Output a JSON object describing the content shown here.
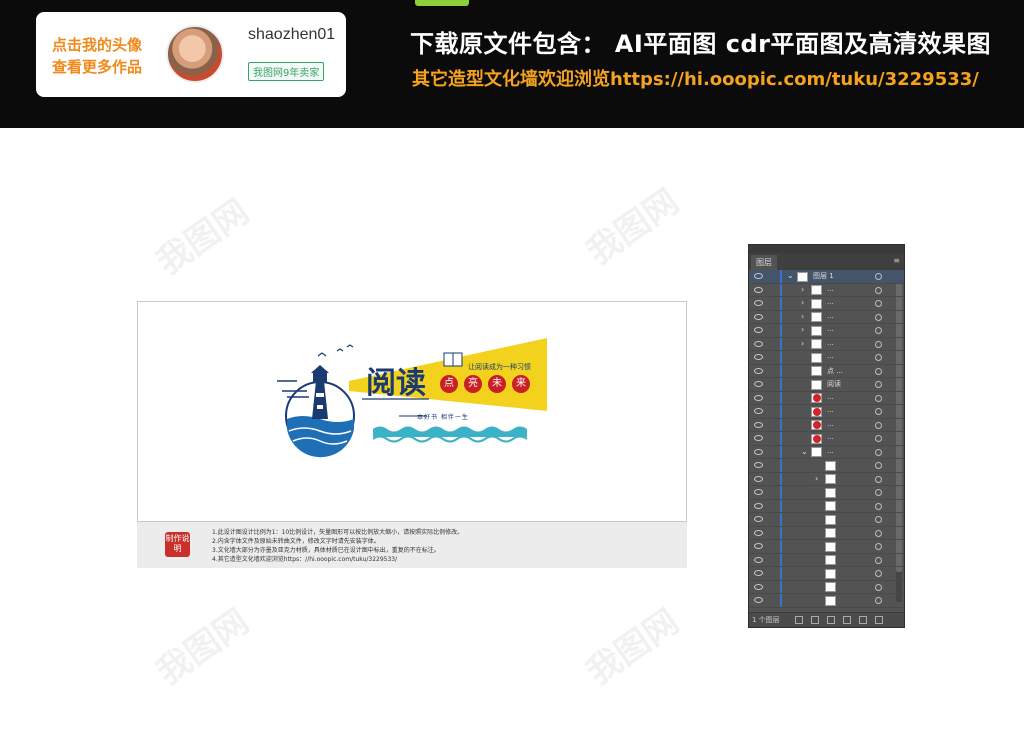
{
  "banner": {
    "author_cta": "点击我的头像 查看更多作品",
    "author_name": "shaozhen01",
    "seller_badge": "我图网9年卖家",
    "headline": "下载原文件包含： AI平面图  cdr平面图及高清效果图",
    "subline": "其它造型文化墙欢迎浏览https://hi.ooopic.com/tuku/3229533/"
  },
  "watermark": "我图网",
  "design": {
    "title": "阅读",
    "slogan": "让阅读成为一种习惯",
    "circle_words": [
      "点",
      "亮",
      "未",
      "来"
    ],
    "motto": "一本好书  相伴一生",
    "colors": {
      "navy": "#1a3a72",
      "yellow": "#f3d21e",
      "red": "#c91f25",
      "sea": "#2a8fc9"
    }
  },
  "notes": {
    "seal": "制作说明",
    "lines": [
      "1.此设计图设计比例为1：10比例设计，矢量图形可以按比例放大缩小，请按照实际比例修改。",
      "2.内含字体文件及原始未转曲文件，修改文字时请先安装字体。",
      "3.文化墙大部分为亦墨及亚克力材质，具体材质已在设计图中标出，重复的不在标注。",
      "4.其它造型文化墙欢迎浏览https：//hi.ooopic.com/tuku/3229533/"
    ]
  },
  "layers_panel": {
    "tab": "图层",
    "footer_count": "1 个图层",
    "rows": [
      {
        "name": "图层 1",
        "indent": 0,
        "twisty": "⌄",
        "thumb": "plain",
        "selected": true
      },
      {
        "name": "...",
        "indent": 1,
        "twisty": "›",
        "thumb": "plain"
      },
      {
        "name": "...",
        "indent": 1,
        "twisty": "›",
        "thumb": "plain"
      },
      {
        "name": "...",
        "indent": 1,
        "twisty": "›",
        "thumb": "plain"
      },
      {
        "name": "...",
        "indent": 1,
        "twisty": "›",
        "thumb": "plain"
      },
      {
        "name": "...",
        "indent": 1,
        "twisty": "›",
        "thumb": "plain"
      },
      {
        "name": "...",
        "indent": 1,
        "twisty": "",
        "thumb": "plain"
      },
      {
        "name": "点 ...",
        "indent": 1,
        "twisty": "",
        "thumb": "plain"
      },
      {
        "name": "阅读",
        "indent": 1,
        "twisty": "",
        "thumb": "plain"
      },
      {
        "name": "...",
        "indent": 1,
        "twisty": "",
        "thumb": "red"
      },
      {
        "name": "...",
        "indent": 1,
        "twisty": "",
        "thumb": "red"
      },
      {
        "name": "...",
        "indent": 1,
        "twisty": "",
        "thumb": "red"
      },
      {
        "name": "...",
        "indent": 1,
        "twisty": "",
        "thumb": "red"
      },
      {
        "name": "...",
        "indent": 1,
        "twisty": "⌄",
        "thumb": "plain"
      },
      {
        "name": "",
        "indent": 2,
        "twisty": "",
        "thumb": "plain"
      },
      {
        "name": "",
        "indent": 2,
        "twisty": "›",
        "thumb": "plain"
      },
      {
        "name": "",
        "indent": 2,
        "twisty": "",
        "thumb": "plain"
      },
      {
        "name": "",
        "indent": 2,
        "twisty": "",
        "thumb": "plain"
      },
      {
        "name": "",
        "indent": 2,
        "twisty": "",
        "thumb": "plain"
      },
      {
        "name": "",
        "indent": 2,
        "twisty": "",
        "thumb": "plain"
      },
      {
        "name": "",
        "indent": 2,
        "twisty": "",
        "thumb": "plain"
      },
      {
        "name": "",
        "indent": 2,
        "twisty": "",
        "thumb": "plain"
      },
      {
        "name": "",
        "indent": 2,
        "twisty": "",
        "thumb": "plain"
      },
      {
        "name": "",
        "indent": 2,
        "twisty": "",
        "thumb": "plain"
      },
      {
        "name": "",
        "indent": 2,
        "twisty": "",
        "thumb": "plain"
      }
    ]
  }
}
